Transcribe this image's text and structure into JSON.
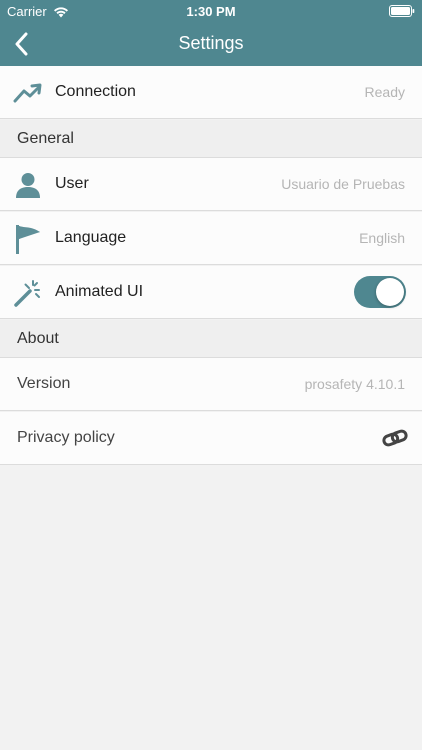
{
  "status_bar": {
    "carrier": "Carrier",
    "time": "1:30 PM"
  },
  "nav": {
    "title": "Settings",
    "back_icon": "chevron-left-icon"
  },
  "connection": {
    "label": "Connection",
    "value": "Ready",
    "icon": "trend-up-icon"
  },
  "sections": {
    "general": "General",
    "about": "About"
  },
  "general": {
    "user": {
      "label": "User",
      "value": "Usuario de Pruebas",
      "icon": "user-icon"
    },
    "language": {
      "label": "Language",
      "value": "English",
      "icon": "flag-icon"
    },
    "animated_ui": {
      "label": "Animated UI",
      "enabled": true,
      "icon": "magic-wand-icon"
    }
  },
  "about": {
    "version": {
      "label": "Version",
      "value": "prosafety 4.10.1"
    },
    "privacy": {
      "label": "Privacy policy",
      "icon": "link-icon"
    }
  },
  "colors": {
    "accent": "#4f8790",
    "icon": "#5e8f98",
    "background": "#f2f2f2"
  }
}
